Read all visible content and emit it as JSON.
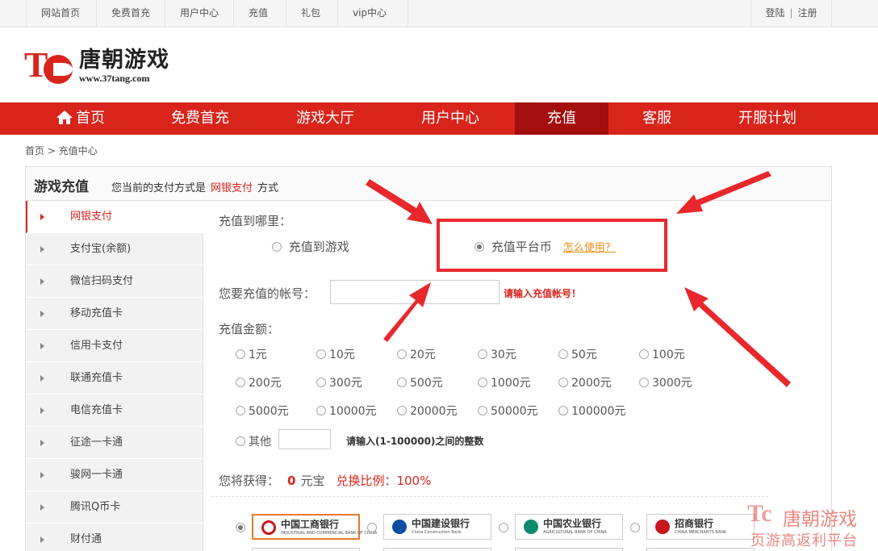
{
  "topbar": {
    "links": [
      "网站首页",
      "免费首充",
      "用户中心",
      "充值",
      "礼包",
      "vip中心"
    ],
    "login": "登陆",
    "separator": "|",
    "register": "注册"
  },
  "logo": {
    "mark": "Tc",
    "name": "唐朝游戏",
    "url": "www.37tang.com"
  },
  "nav": {
    "items": [
      "首页",
      "免费首充",
      "游戏大厅",
      "用户中心",
      "充值",
      "客服",
      "开服计划"
    ],
    "active": "充值"
  },
  "breadcrumb": "首页 > 充值中心",
  "panel": {
    "title": "游戏充值",
    "desc_prefix": "您当前的支付方式是",
    "desc_method": "网银支付",
    "desc_suffix": "方式"
  },
  "sidebar": {
    "items": [
      "网银支付",
      "支付宝(余额)",
      "微信扫码支付",
      "移动充值卡",
      "信用卡支付",
      "联通充值卡",
      "电信充值卡",
      "征途一卡通",
      "骏网一卡通",
      "腾讯Q币卡",
      "财付通"
    ],
    "active": "网银支付"
  },
  "form": {
    "target_label": "充值到哪里：",
    "target_game": "充值到游戏",
    "target_platform": "充值平台币",
    "howto": "怎么使用？",
    "account_label": "您要充值的帐号：",
    "account_value": "",
    "account_warning": "请输入充值帐号！",
    "amount_label": "充值金额：",
    "amounts": [
      "1元",
      "10元",
      "20元",
      "30元",
      "50元",
      "100元",
      "200元",
      "300元",
      "500元",
      "1000元",
      "2000元",
      "3000元",
      "5000元",
      "10000元",
      "20000元",
      "50000元",
      "100000元"
    ],
    "other_label": "其他",
    "other_value": "",
    "other_hint": "请输入(1-100000)之间的整数",
    "get_label": "您将获得：",
    "get_value": "0",
    "get_unit": "元宝",
    "ratio": "兑换比例：100%"
  },
  "banks": [
    {
      "name": "中国工商银行",
      "en": "INDUSTRIAL AND COMMERCIAL BANK OF CHINA",
      "color": "#c8161d",
      "selected": true
    },
    {
      "name": "中国建设银行",
      "en": "China Construction Bank",
      "color": "#0b4ea2",
      "selected": false
    },
    {
      "name": "中国农业银行",
      "en": "AGRICULTURAL BANK OF CHINA",
      "color": "#0f8a6f",
      "selected": false
    },
    {
      "name": "招商银行",
      "en": "CHINA MERCHANTS BANK",
      "color": "#c8161d",
      "selected": false
    }
  ],
  "watermark": {
    "mark": "Tc",
    "name": "唐朝游戏",
    "slogan": "页游高返利平台"
  },
  "colors": {
    "brand_red": "#d9241c",
    "nav_active": "#a40e0e",
    "highlight": "#e8282c",
    "link_orange": "#ee8a12"
  }
}
